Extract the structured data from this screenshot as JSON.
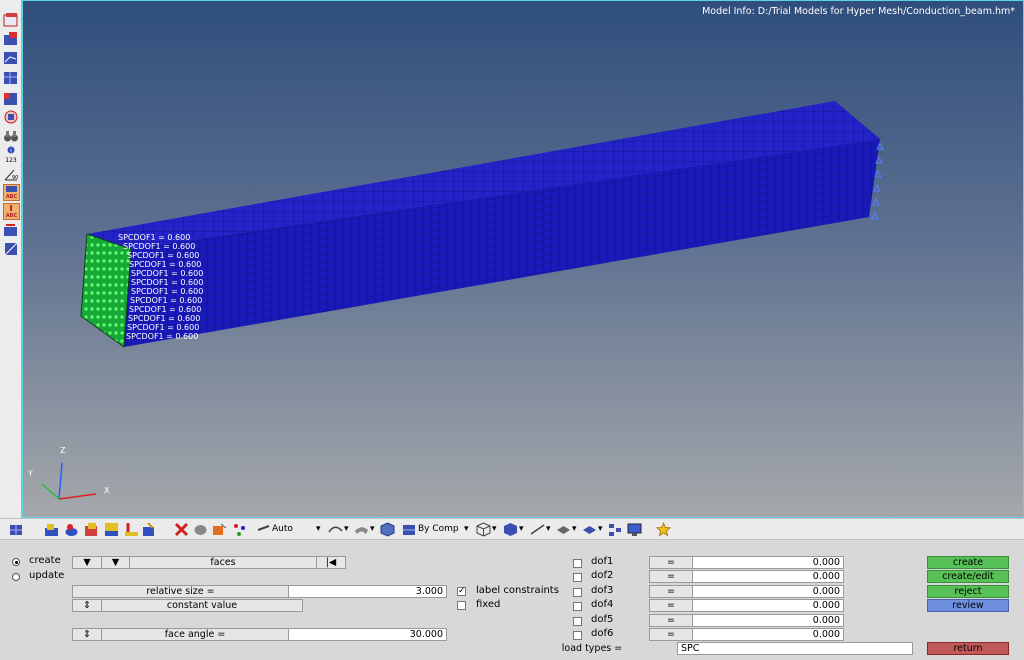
{
  "viewport": {
    "model_info": "Model Info: D:/Trial Models for Hyper Mesh/Conduction_beam.hm*",
    "constraint_label": "SPCDOF1 = 0.600",
    "axes": {
      "z": "Z",
      "y": "Y",
      "x": "X"
    }
  },
  "left_toolbar": {
    "icons": [
      "panel-icon-1",
      "panel-icon-2",
      "panel-icon-3",
      "panel-icon-4",
      "panel-icon-5",
      "panel-icon-6",
      "binoculars-icon",
      "info-123-icon",
      "angle-icon",
      "abc-label-icon",
      "abc-load-icon",
      "move-icon",
      "edit-icon"
    ],
    "info_text": "123",
    "angle_text": "90°",
    "abc_text": "ABC"
  },
  "bottom_toolbar": {
    "auto_label": "Auto",
    "by_comp_label": "By Comp"
  },
  "panel": {
    "radio_create": "create",
    "radio_update": "update",
    "faces_button": "faces",
    "relative_size_label": "relative size =",
    "relative_size_value": "3.000",
    "constant_value": "constant value",
    "face_angle_label": "face angle =",
    "face_angle_value": "30.000",
    "label_constraints": "label constraints",
    "fixed": "fixed",
    "dofs": [
      {
        "name": "dof1",
        "eq": "=",
        "value": "0.000"
      },
      {
        "name": "dof2",
        "eq": "=",
        "value": "0.000"
      },
      {
        "name": "dof3",
        "eq": "=",
        "value": "0.000"
      },
      {
        "name": "dof4",
        "eq": "=",
        "value": "0.000"
      },
      {
        "name": "dof5",
        "eq": "=",
        "value": "0.000"
      },
      {
        "name": "dof6",
        "eq": "=",
        "value": "0.000"
      }
    ],
    "load_types_label": "load types =",
    "load_types_value": "SPC",
    "buttons": {
      "create": "create",
      "create_edit": "create/edit",
      "reject": "reject",
      "review": "review",
      "return": "return"
    },
    "toggle_label": "⇕",
    "arrow_down": "▼",
    "first_icon": "|◀"
  },
  "colors": {
    "mesh_blue": "#2020d8",
    "spc_green": "#3ee05a",
    "viewport_top": "#2f4e7c",
    "viewport_bottom": "#a5a8ab",
    "action_green": "#57c057",
    "review_blue": "#6f8fe0",
    "return_red": "#c25a5a"
  }
}
